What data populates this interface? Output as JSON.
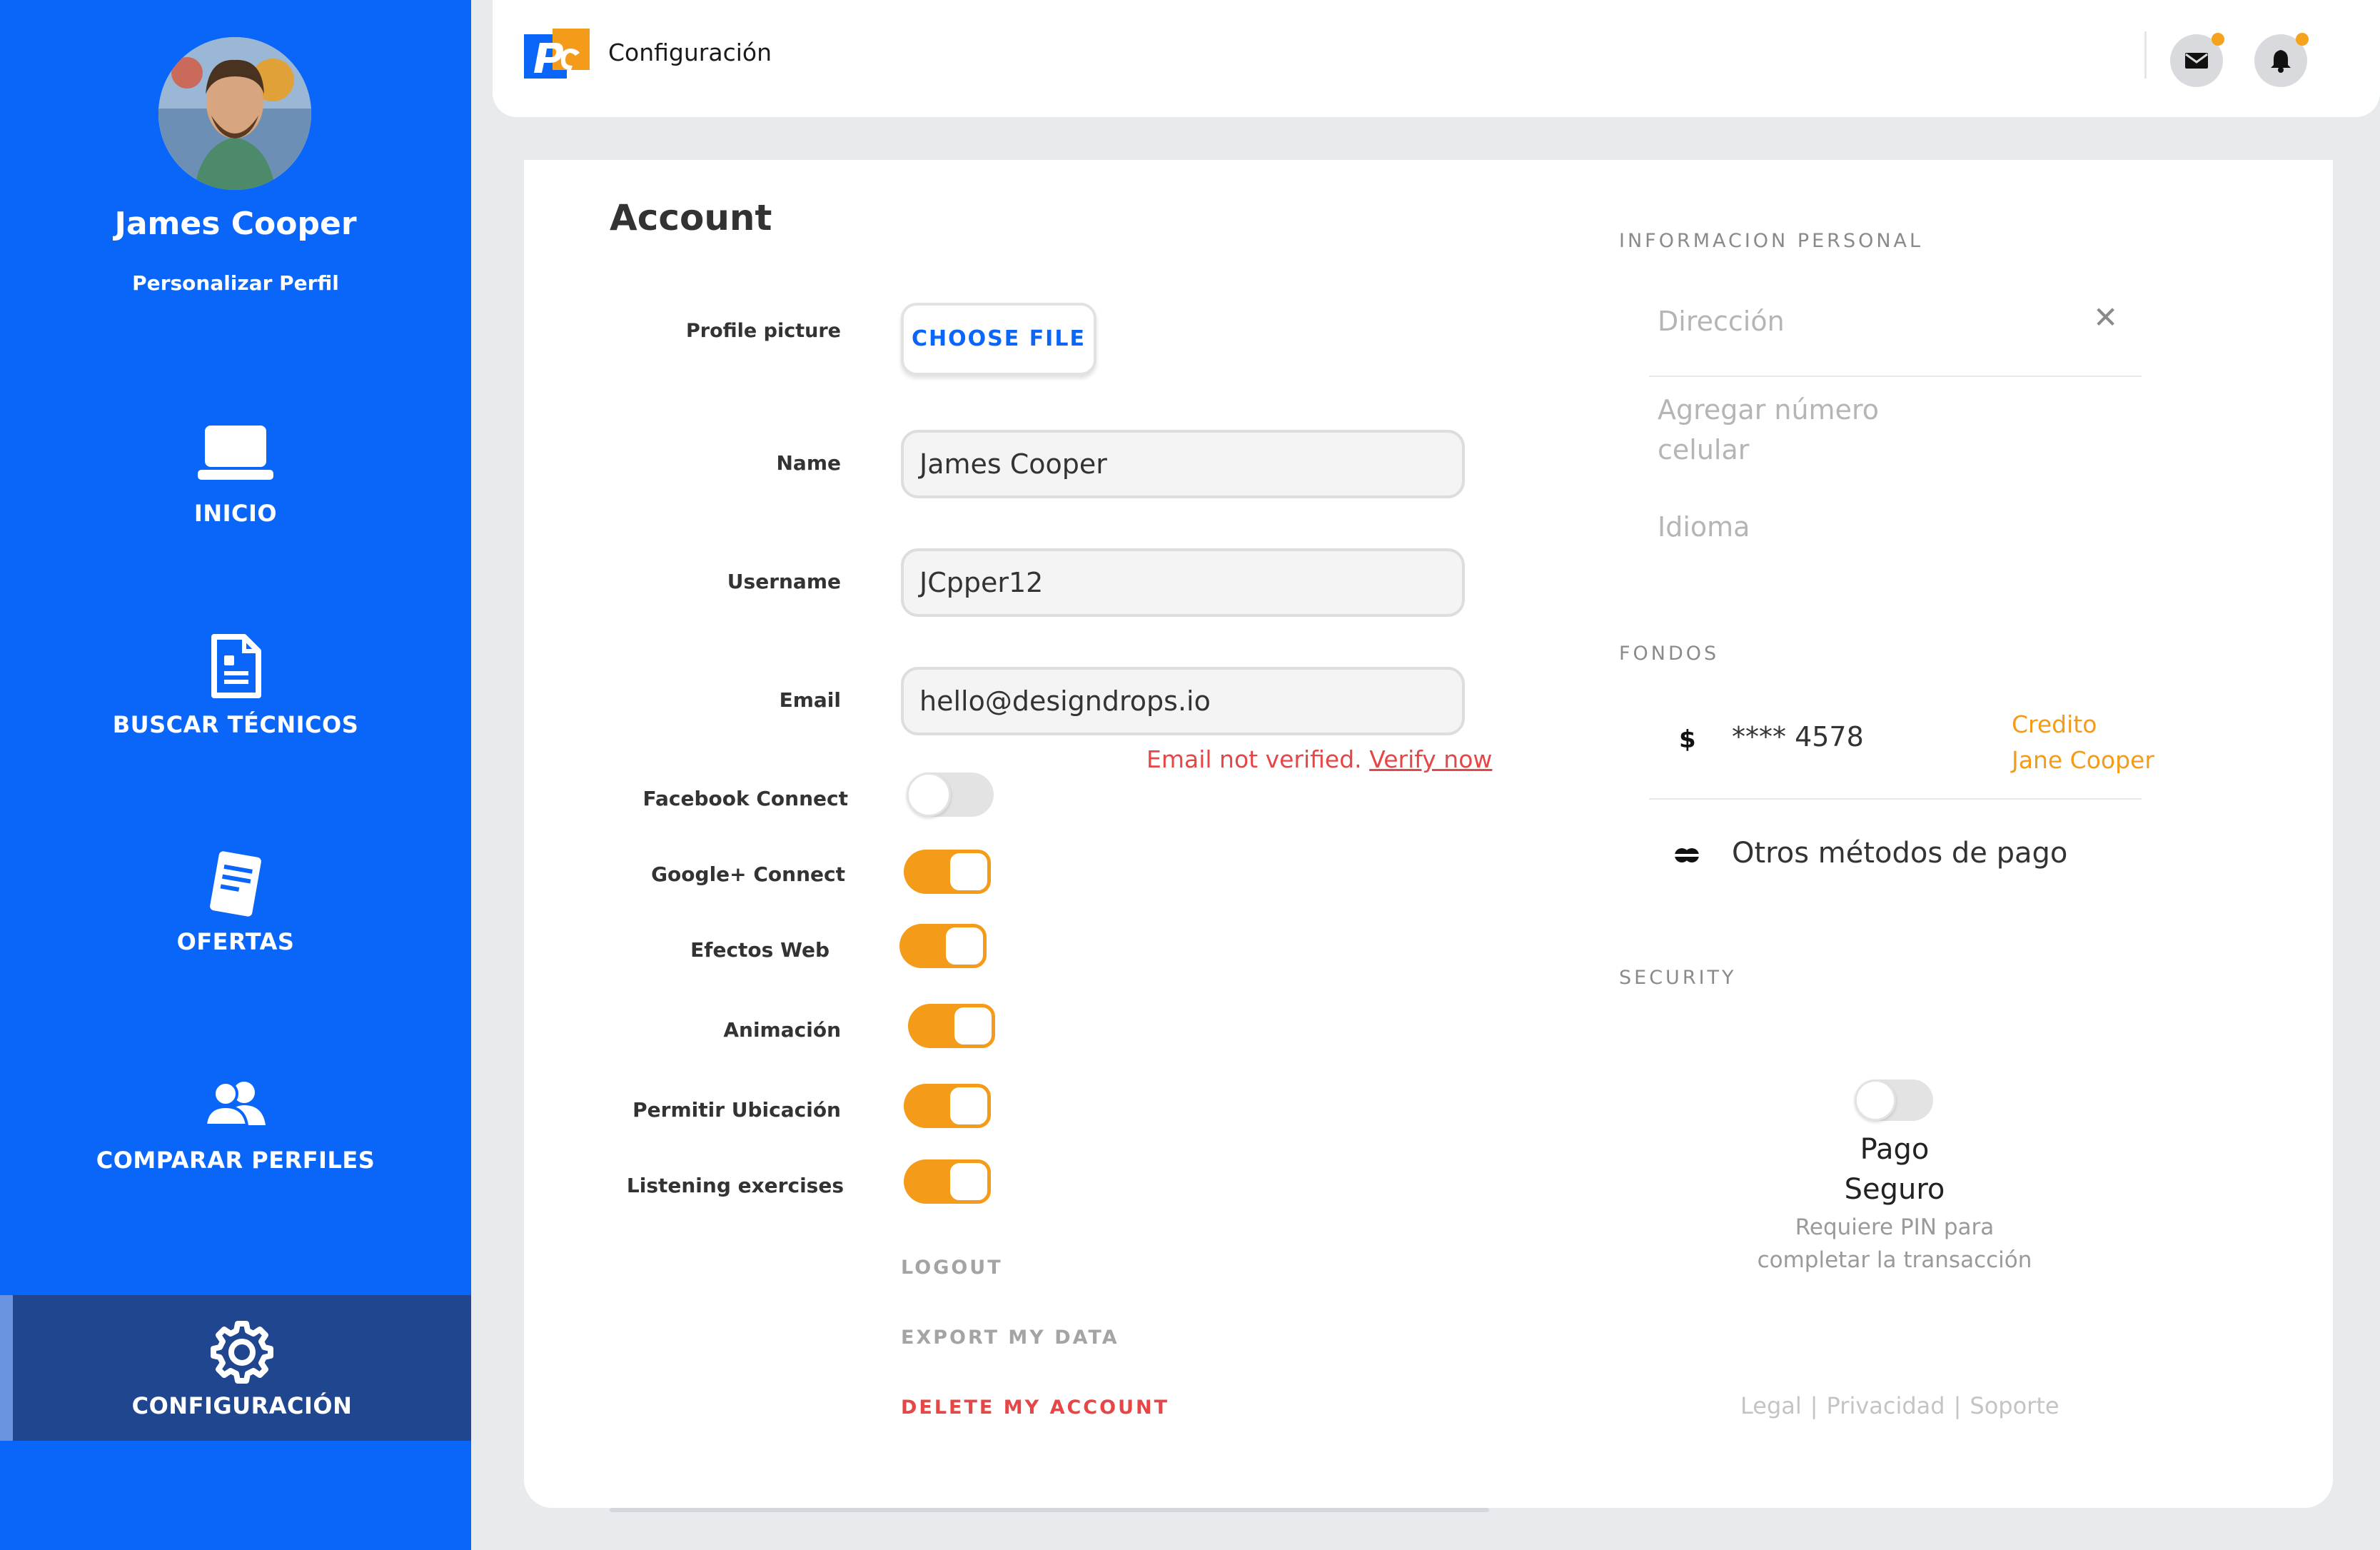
{
  "sidebar": {
    "user_name": "James Cooper",
    "customize_link": "Personalizar Perfil",
    "items": [
      {
        "label": "INICIO",
        "icon": "laptop-icon"
      },
      {
        "label": "BUSCAR TÉCNICOS",
        "icon": "document-icon"
      },
      {
        "label": "OFERTAS",
        "icon": "note-icon"
      },
      {
        "label": "COMPARAR PERFILES",
        "icon": "users-icon"
      },
      {
        "label": "CONFIGURACIÓN",
        "icon": "gear-icon",
        "active": true
      }
    ]
  },
  "header": {
    "title": "Configuración",
    "icons": [
      "mail-icon",
      "bell-icon"
    ],
    "notification_dot_color": "#f5a21c"
  },
  "account": {
    "title": "Account",
    "profile_picture_label": "Profile picture",
    "choose_file_label": "CHOOSE FILE",
    "name_label": "Name",
    "name_value": "James Cooper",
    "username_label": "Username",
    "username_value": "JCpper12",
    "email_label": "Email",
    "email_value": "hello@designdrops.io",
    "email_warning": "Email not verified.",
    "verify_link": "Verify now",
    "toggles": [
      {
        "label": "Facebook Connect",
        "on": false
      },
      {
        "label": "Google+ Connect",
        "on": true
      },
      {
        "label": "Efectos Web",
        "on": true
      },
      {
        "label": "Animación",
        "on": true
      },
      {
        "label": "Permitir Ubicación",
        "on": true
      },
      {
        "label": "Listening exercises",
        "on": true
      }
    ],
    "logout_label": "LOGOUT",
    "export_label": "EXPORT MY DATA",
    "delete_label": "DELETE MY ACCOUNT"
  },
  "personal_info": {
    "heading": "INFORMACION PERSONAL",
    "address_placeholder": "Dirección",
    "phone_placeholder_line1": "Agregar número",
    "phone_placeholder_line2": "celular",
    "language_placeholder": "Idioma"
  },
  "funds": {
    "heading": "FONDOS",
    "currency_symbol": "$",
    "card_masked": "**** 4578",
    "credit_label": "Credito",
    "credit_holder": "Jane Cooper",
    "other_methods": "Otros métodos de pago"
  },
  "security": {
    "heading": "SECURITY",
    "secure_payment_on": false,
    "title_line1": "Pago",
    "title_line2": "Seguro",
    "desc_line1": "Requiere PIN para",
    "desc_line2": "completar la transacción"
  },
  "footer": {
    "legal": "Legal",
    "privacy": "Privacidad",
    "support": "Soporte",
    "separator": "|"
  },
  "colors": {
    "sidebar_blue": "#0a66f8",
    "active_nav": "#1f468e",
    "accent_orange": "#f59b1a",
    "danger_red": "#e64646"
  }
}
